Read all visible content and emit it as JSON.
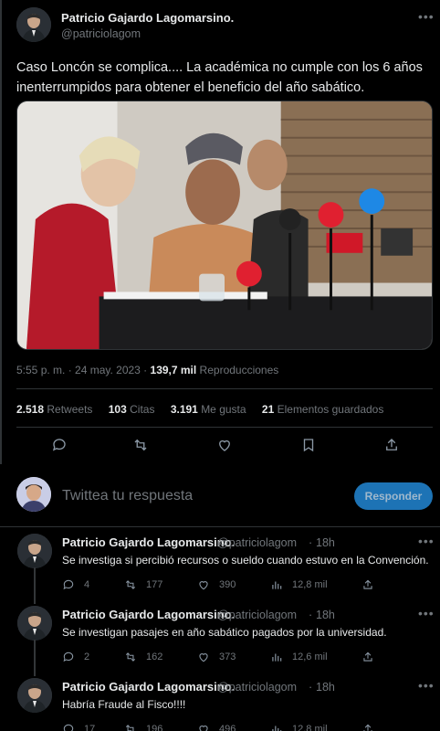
{
  "main_tweet": {
    "author_name": "Patricio Gajardo Lagomarsino.",
    "author_handle": "@patriciolagom",
    "text": "Caso Loncón se complica.... La académica  no cumple con los 6 años inenterrumpidos para obtener el beneficio  del año sabático.",
    "time": "5:55 p. m. · 24 may. 2023 · ",
    "views_count": "139,7 mil",
    "views_label": " Reproducciones",
    "stats": {
      "retweets_count": "2.518",
      "retweets_label": "Retweets",
      "quotes_count": "103",
      "quotes_label": "Citas",
      "likes_count": "3.191",
      "likes_label": "Me gusta",
      "bookmarks_count": "21",
      "bookmarks_label": "Elementos guardados"
    },
    "more_icon": "more-horizontal-icon"
  },
  "reply_composer": {
    "placeholder": "Twittea tu respuesta",
    "button_label": "Responder"
  },
  "replies": [
    {
      "author_name": "Patricio Gajardo Lagomarsino.",
      "author_handle": "@patriciolagom",
      "time": "18h",
      "text": "Se investiga  si percibió recursos o sueldo cuando estuvo en la Convención.",
      "replies": "4",
      "retweets": "177",
      "likes": "390",
      "views": "12,8 mil"
    },
    {
      "author_name": "Patricio Gajardo Lagomarsino.",
      "author_handle": "@patriciolagom",
      "time": "18h",
      "text": "Se investigan pasajes  en año sabático pagados por la universidad.",
      "replies": "2",
      "retweets": "162",
      "likes": "373",
      "views": "12,6 mil"
    },
    {
      "author_name": "Patricio Gajardo Lagomarsino.",
      "author_handle": "@patriciolagom",
      "time": "18h",
      "text": "Habría Fraude al Fisco!!!!",
      "replies": "17",
      "retweets": "196",
      "likes": "496",
      "views": "12,8 mil"
    }
  ],
  "colors": {
    "background": "#000000",
    "text": "#e7e9ea",
    "secondary": "#71767b",
    "accent": "#1d9bf0"
  }
}
